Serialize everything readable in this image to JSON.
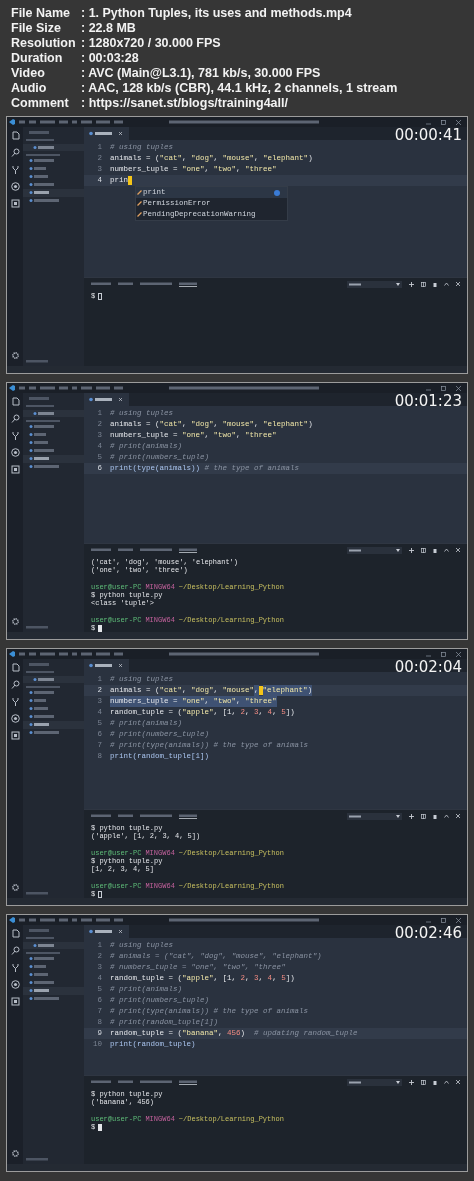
{
  "info": [
    {
      "label": "File Name",
      "value": ": 1. Python Tuples, its uses and methods.mp4"
    },
    {
      "label": "File Size",
      "value": ": 22.8 MB"
    },
    {
      "label": "Resolution",
      "value": ": 1280x720 / 30.000 FPS"
    },
    {
      "label": "Duration",
      "value": ": 00:03:28"
    },
    {
      "label": "Video",
      "value": ": AVC (Main@L3.1), 781 kb/s, 30.000 FPS"
    },
    {
      "label": "Audio",
      "value": ": AAC, 128 kb/s (CBR), 44.1 kHz, 2 channels, 1 stream"
    },
    {
      "label": "Comment",
      "value": ": https://sanet.st/blogs/training4all/"
    }
  ],
  "frames": [
    {
      "timestamp": "00:00:41",
      "code": [
        {
          "number": "1",
          "current": false,
          "tokens": [
            {
              "kind": "comment",
              "text": "# using tuples"
            }
          ]
        },
        {
          "number": "2",
          "current": false,
          "tokens": [
            {
              "kind": "plain",
              "text": "animals = ("
            },
            {
              "kind": "str",
              "text": "\"cat\""
            },
            {
              "kind": "plain",
              "text": ", "
            },
            {
              "kind": "str",
              "text": "\"dog\""
            },
            {
              "kind": "plain",
              "text": ", "
            },
            {
              "kind": "str",
              "text": "\"mouse\""
            },
            {
              "kind": "plain",
              "text": ", "
            },
            {
              "kind": "str",
              "text": "\"elephant\""
            },
            {
              "kind": "plain",
              "text": ")"
            }
          ]
        },
        {
          "number": "3",
          "current": false,
          "tokens": [
            {
              "kind": "plain",
              "text": "numbers_tuple = "
            },
            {
              "kind": "str",
              "text": "\"one\""
            },
            {
              "kind": "plain",
              "text": ", "
            },
            {
              "kind": "str",
              "text": "\"two\""
            },
            {
              "kind": "plain",
              "text": ", "
            },
            {
              "kind": "str",
              "text": "\"three\""
            }
          ]
        },
        {
          "number": "4",
          "current": true,
          "tokens": [
            {
              "kind": "plain",
              "text": "prin"
            },
            {
              "kind": "caret"
            }
          ]
        }
      ],
      "autocomplete": [
        {
          "text": "print",
          "selected": true
        },
        {
          "text": "PermissionError",
          "selected": false
        },
        {
          "text": "PendingDeprecationWarning",
          "selected": false
        }
      ],
      "terminal": [
        {
          "kind": "input",
          "text": "$",
          "focused": false
        }
      ]
    },
    {
      "timestamp": "00:01:23",
      "code": [
        {
          "number": "1",
          "current": false,
          "tokens": [
            {
              "kind": "comment",
              "text": "# using tuples"
            }
          ]
        },
        {
          "number": "2",
          "current": false,
          "tokens": [
            {
              "kind": "plain",
              "text": "animals = ("
            },
            {
              "kind": "str",
              "text": "\"cat\""
            },
            {
              "kind": "plain",
              "text": ", "
            },
            {
              "kind": "str",
              "text": "\"dog\""
            },
            {
              "kind": "plain",
              "text": ", "
            },
            {
              "kind": "str",
              "text": "\"mouse\""
            },
            {
              "kind": "plain",
              "text": ", "
            },
            {
              "kind": "str",
              "text": "\"elephant\""
            },
            {
              "kind": "plain",
              "text": ")"
            }
          ]
        },
        {
          "number": "3",
          "current": false,
          "tokens": [
            {
              "kind": "plain",
              "text": "numbers_tuple = "
            },
            {
              "kind": "str",
              "text": "\"one\""
            },
            {
              "kind": "plain",
              "text": ", "
            },
            {
              "kind": "str",
              "text": "\"two\""
            },
            {
              "kind": "plain",
              "text": ", "
            },
            {
              "kind": "str",
              "text": "\"three\""
            }
          ]
        },
        {
          "number": "4",
          "current": false,
          "tokens": [
            {
              "kind": "comment",
              "text": "# print(animals)"
            }
          ]
        },
        {
          "number": "5",
          "current": false,
          "tokens": [
            {
              "kind": "comment",
              "text": "# print(numbers_tuple)"
            }
          ]
        },
        {
          "number": "6",
          "current": true,
          "tokens": [
            {
              "kind": "call",
              "text": "print(type(animals))"
            },
            {
              "kind": "comment",
              "text": " # the type of animals"
            }
          ]
        }
      ],
      "terminal": [
        {
          "kind": "plain",
          "text": "('cat', 'dog', 'mouse', 'elephant')"
        },
        {
          "kind": "plain",
          "text": "('one', 'two', 'three')"
        },
        {
          "kind": "blank"
        },
        {
          "kind": "prompt",
          "user": "user@user-PC",
          "host": "MINGW64",
          "path": "~/Desktop/Learning_Python"
        },
        {
          "kind": "plain",
          "text": "$ python tuple.py"
        },
        {
          "kind": "plain",
          "text": "<class 'tuple'>"
        },
        {
          "kind": "blank"
        },
        {
          "kind": "prompt",
          "user": "user@user-PC",
          "host": "MINGW64",
          "path": "~/Desktop/Learning_Python"
        },
        {
          "kind": "input",
          "text": "$",
          "focused": true
        }
      ]
    },
    {
      "timestamp": "00:02:04",
      "code": [
        {
          "number": "1",
          "current": false,
          "tokens": [
            {
              "kind": "comment",
              "text": "# using tuples"
            }
          ]
        },
        {
          "number": "2",
          "current": true,
          "tokens": [
            {
              "kind": "plain",
              "text": "animals = ("
            },
            {
              "kind": "str",
              "text": "\"cat\""
            },
            {
              "kind": "plain",
              "text": ", "
            },
            {
              "kind": "str",
              "text": "\"dog\""
            },
            {
              "kind": "plain",
              "text": ", "
            },
            {
              "kind": "str",
              "text": "\"mouse\""
            },
            {
              "kind": "plain",
              "text": ",",
              "highlighted": true
            },
            {
              "kind": "caret"
            },
            {
              "kind": "str",
              "text": "\"elephant\"",
              "highlighted": true
            },
            {
              "kind": "plain",
              "text": ")",
              "highlighted": true
            }
          ]
        },
        {
          "number": "3",
          "current": false,
          "tokens": [
            {
              "kind": "plain",
              "text": "numbers_tuple = ",
              "highlighted": true
            },
            {
              "kind": "str",
              "text": "\"one\"",
              "highlighted": true
            },
            {
              "kind": "plain",
              "text": ", ",
              "highlighted": true
            },
            {
              "kind": "str",
              "text": "\"two\"",
              "highlighted": true
            },
            {
              "kind": "plain",
              "text": ", ",
              "highlighted": true
            },
            {
              "kind": "str",
              "text": "\"three\"",
              "highlighted": true
            }
          ]
        },
        {
          "number": "4",
          "current": false,
          "tokens": [
            {
              "kind": "plain",
              "text": "random_tuple = ("
            },
            {
              "kind": "str",
              "text": "\"apple\""
            },
            {
              "kind": "plain",
              "text": ", [1, "
            },
            {
              "kind": "num",
              "text": "2"
            },
            {
              "kind": "plain",
              "text": ", "
            },
            {
              "kind": "num",
              "text": "3"
            },
            {
              "kind": "plain",
              "text": ", "
            },
            {
              "kind": "num",
              "text": "4"
            },
            {
              "kind": "plain",
              "text": ", "
            },
            {
              "kind": "num",
              "text": "5"
            },
            {
              "kind": "plain",
              "text": "])"
            }
          ]
        },
        {
          "number": "5",
          "current": false,
          "tokens": [
            {
              "kind": "comment",
              "text": "# print(animals)"
            }
          ]
        },
        {
          "number": "6",
          "current": false,
          "tokens": [
            {
              "kind": "comment",
              "text": "# print(numbers_tuple)"
            }
          ]
        },
        {
          "number": "7",
          "current": false,
          "tokens": [
            {
              "kind": "comment",
              "text": "# print(type(animals)) # the type of animals"
            }
          ]
        },
        {
          "number": "8",
          "current": false,
          "tokens": [
            {
              "kind": "call",
              "text": "print(random_tuple[1])"
            }
          ]
        }
      ],
      "terminal": [
        {
          "kind": "plain",
          "text": "$ python tuple.py"
        },
        {
          "kind": "plain",
          "text": "('apple', [1, 2, 3, 4, 5])"
        },
        {
          "kind": "blank"
        },
        {
          "kind": "prompt",
          "user": "user@user-PC",
          "host": "MINGW64",
          "path": "~/Desktop/Learning_Python"
        },
        {
          "kind": "plain",
          "text": "$ python tuple.py"
        },
        {
          "kind": "plain",
          "text": "[1, 2, 3, 4, 5]"
        },
        {
          "kind": "blank"
        },
        {
          "kind": "prompt",
          "user": "user@user-PC",
          "host": "MINGW64",
          "path": "~/Desktop/Learning_Python"
        },
        {
          "kind": "input",
          "text": "$",
          "focused": false
        }
      ]
    },
    {
      "timestamp": "00:02:46",
      "code": [
        {
          "number": "1",
          "current": false,
          "tokens": [
            {
              "kind": "comment",
              "text": "# using tuples"
            }
          ]
        },
        {
          "number": "2",
          "current": false,
          "tokens": [
            {
              "kind": "comment",
              "text": "# animals = (\"cat\", \"dog\", \"mouse\", \"elephant\")"
            }
          ]
        },
        {
          "number": "3",
          "current": false,
          "tokens": [
            {
              "kind": "comment",
              "text": "# numbers_tuple = \"one\", \"two\", \"three\""
            }
          ]
        },
        {
          "number": "4",
          "current": false,
          "tokens": [
            {
              "kind": "plain",
              "text": "random_tuple = ("
            },
            {
              "kind": "str",
              "text": "\"apple\""
            },
            {
              "kind": "plain",
              "text": ", [1, "
            },
            {
              "kind": "num",
              "text": "2"
            },
            {
              "kind": "plain",
              "text": ", "
            },
            {
              "kind": "num",
              "text": "3"
            },
            {
              "kind": "plain",
              "text": ", "
            },
            {
              "kind": "num",
              "text": "4"
            },
            {
              "kind": "plain",
              "text": ", "
            },
            {
              "kind": "num",
              "text": "5"
            },
            {
              "kind": "plain",
              "text": "])"
            }
          ]
        },
        {
          "number": "5",
          "current": false,
          "tokens": [
            {
              "kind": "comment",
              "text": "# print(animals)"
            }
          ]
        },
        {
          "number": "6",
          "current": false,
          "tokens": [
            {
              "kind": "comment",
              "text": "# print(numbers_tuple)"
            }
          ]
        },
        {
          "number": "7",
          "current": false,
          "tokens": [
            {
              "kind": "comment",
              "text": "# print(type(animals)) # the type of animals"
            }
          ]
        },
        {
          "number": "8",
          "current": false,
          "tokens": [
            {
              "kind": "comment",
              "text": "# print(random_tuple[1])"
            }
          ]
        },
        {
          "number": "9",
          "current": true,
          "tokens": [
            {
              "kind": "plain",
              "text": "random_tuple = ("
            },
            {
              "kind": "str",
              "text": "\"banana\""
            },
            {
              "kind": "plain",
              "text": ", "
            },
            {
              "kind": "num",
              "text": "456"
            },
            {
              "kind": "plain",
              "text": ")  "
            },
            {
              "kind": "comment",
              "text": "# updating random_tuple"
            }
          ]
        },
        {
          "number": "10",
          "current": false,
          "tokens": [
            {
              "kind": "call",
              "text": "print(random_tuple)"
            }
          ]
        }
      ],
      "terminal": [
        {
          "kind": "plain",
          "text": "$ python tuple.py"
        },
        {
          "kind": "plain",
          "text": "('banana', 456)"
        },
        {
          "kind": "blank"
        },
        {
          "kind": "prompt",
          "user": "user@user-PC",
          "host": "MINGW64",
          "path": "~/Desktop/Learning_Python"
        },
        {
          "kind": "input",
          "text": "$",
          "focused": true
        }
      ]
    }
  ]
}
